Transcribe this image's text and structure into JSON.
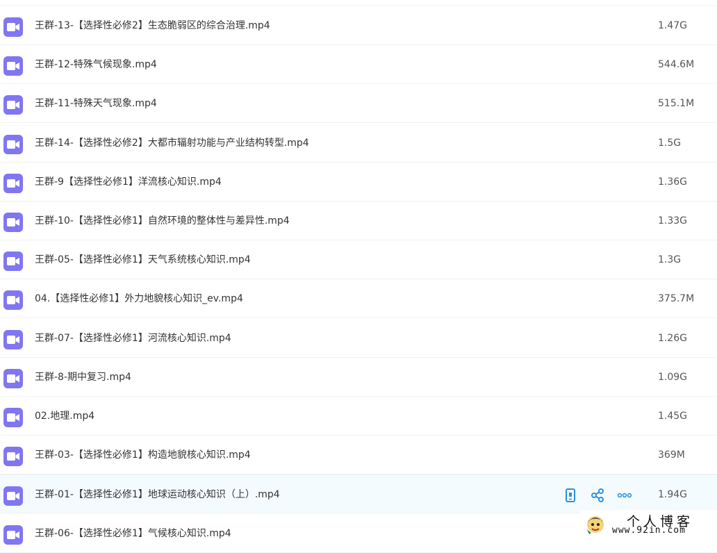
{
  "files": [
    {
      "name": "王群-13-【选择性必修2】生态脆弱区的综合治理.mp4",
      "size": "1.47G",
      "icon": "video-file-icon"
    },
    {
      "name": "王群-12-特殊气候现象.mp4",
      "size": "544.6M",
      "icon": "video-file-icon"
    },
    {
      "name": "王群-11-特殊天气现象.mp4",
      "size": "515.1M",
      "icon": "video-file-icon"
    },
    {
      "name": "王群-14-【选择性必修2】大都市辐射功能与产业结构转型.mp4",
      "size": "1.5G",
      "icon": "video-file-icon"
    },
    {
      "name": "王群-9【选择性必修1】洋流核心知识.mp4",
      "size": "1.36G",
      "icon": "video-file-icon"
    },
    {
      "name": "王群-10-【选择性必修1】自然环境的整体性与差异性.mp4",
      "size": "1.33G",
      "icon": "video-file-icon"
    },
    {
      "name": "王群-05-【选择性必修1】天气系统核心知识.mp4",
      "size": "1.3G",
      "icon": "video-file-icon"
    },
    {
      "name": "04.【选择性必修1】外力地貌核心知识_ev.mp4",
      "size": "375.7M",
      "icon": "video-file-icon"
    },
    {
      "name": "王群-07-【选择性必修1】河流核心知识.mp4",
      "size": "1.26G",
      "icon": "video-file-icon"
    },
    {
      "name": "王群-8-期中复习.mp4",
      "size": "1.09G",
      "icon": "video-file-icon"
    },
    {
      "name": "02.地理.mp4",
      "size": "1.45G",
      "icon": "video-file-icon"
    },
    {
      "name": "王群-03-【选择性必修1】构造地貌核心知识.mp4",
      "size": "369M",
      "icon": "video-file-icon"
    },
    {
      "name": "王群-01-【选择性必修1】地球运动核心知识（上）.mp4",
      "size": "1.94G",
      "icon": "video-file-icon",
      "hovered": true
    },
    {
      "name": "王群-06-【选择性必修1】气候核心知识.mp4",
      "size": "",
      "icon": "video-file-icon"
    }
  ],
  "row_actions": [
    "phone-icon",
    "share-icon",
    "more-icon"
  ],
  "colors": {
    "file_icon": "#8076f2",
    "action_icon": "#2f8fdb",
    "hover_row": "#f4fbff"
  },
  "watermark": {
    "title": "个人博客",
    "url": "www.92in.com"
  }
}
